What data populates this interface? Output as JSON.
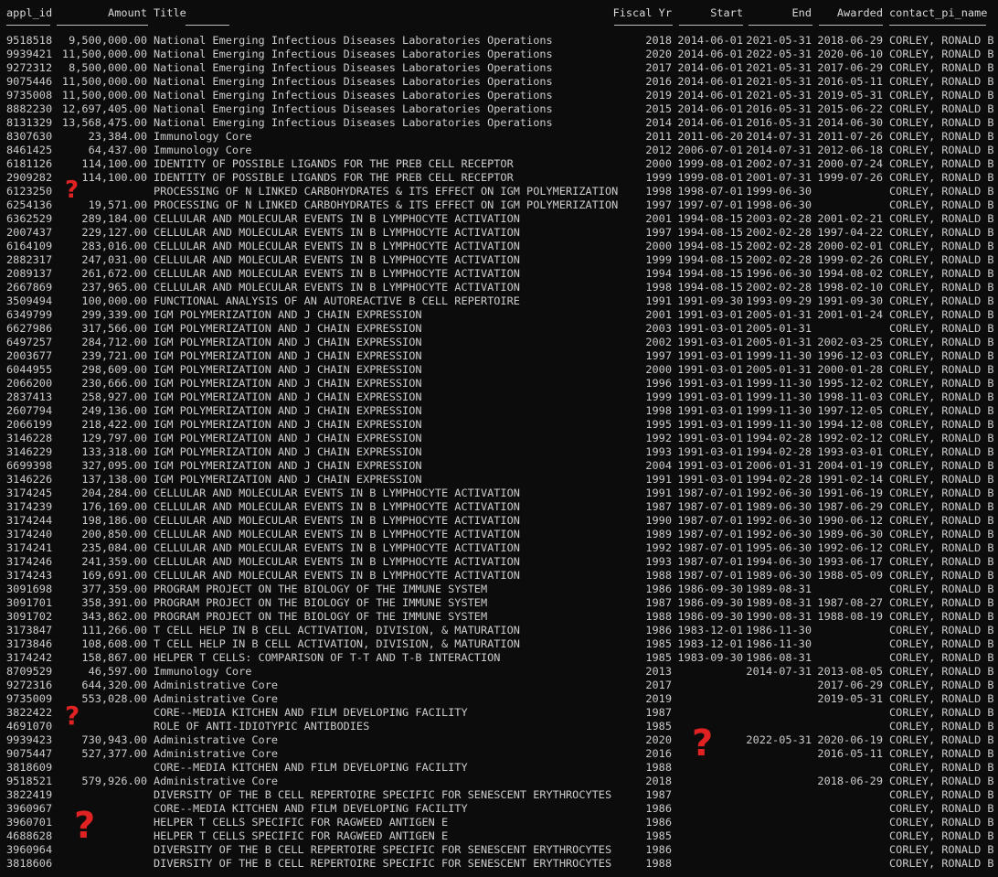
{
  "headers": [
    "appl_id",
    "Amount",
    "Title",
    "Fiscal Yr",
    "Start",
    "End",
    "Awarded",
    "contact_pi_name"
  ],
  "rows": [
    [
      "9518518",
      "9,500,000.00",
      "National Emerging Infectious Diseases Laboratories Operations",
      "2018",
      "2014-06-01",
      "2021-05-31",
      "2018-06-29",
      "CORLEY, RONALD B"
    ],
    [
      "9939421",
      "11,500,000.00",
      "National Emerging Infectious Diseases Laboratories Operations",
      "2020",
      "2014-06-01",
      "2022-05-31",
      "2020-06-10",
      "CORLEY, RONALD B"
    ],
    [
      "9272312",
      "8,500,000.00",
      "National Emerging Infectious Diseases Laboratories Operations",
      "2017",
      "2014-06-01",
      "2021-05-31",
      "2017-06-29",
      "CORLEY, RONALD B"
    ],
    [
      "9075446",
      "11,500,000.00",
      "National Emerging Infectious Diseases Laboratories Operations",
      "2016",
      "2014-06-01",
      "2021-05-31",
      "2016-05-11",
      "CORLEY, RONALD B"
    ],
    [
      "9735008",
      "11,500,000.00",
      "National Emerging Infectious Diseases Laboratories Operations",
      "2019",
      "2014-06-01",
      "2021-05-31",
      "2019-05-31",
      "CORLEY, RONALD B"
    ],
    [
      "8882230",
      "12,697,405.00",
      "National Emerging Infectious Diseases Laboratories Operations",
      "2015",
      "2014-06-01",
      "2016-05-31",
      "2015-06-22",
      "CORLEY, RONALD B"
    ],
    [
      "8131329",
      "13,568,475.00",
      "National Emerging Infectious Diseases Laboratories Operations",
      "2014",
      "2014-06-01",
      "2016-05-31",
      "2014-06-30",
      "CORLEY, RONALD B"
    ],
    [
      "8307630",
      "23,384.00",
      "Immunology Core",
      "2011",
      "2011-06-20",
      "2014-07-31",
      "2011-07-26",
      "CORLEY, RONALD B"
    ],
    [
      "8461425",
      "64,437.00",
      "Immunology Core",
      "2012",
      "2006-07-01",
      "2014-07-31",
      "2012-06-18",
      "CORLEY, RONALD B"
    ],
    [
      "6181126",
      "114,100.00",
      "IDENTITY OF POSSIBLE LIGANDS FOR THE PREB CELL RECEPTOR",
      "2000",
      "1999-08-01",
      "2002-07-31",
      "2000-07-24",
      "CORLEY, RONALD B"
    ],
    [
      "2909282",
      "114,100.00",
      "IDENTITY OF POSSIBLE LIGANDS FOR THE PREB CELL RECEPTOR",
      "1999",
      "1999-08-01",
      "2001-07-31",
      "1999-07-26",
      "CORLEY, RONALD B"
    ],
    [
      "6123250",
      "",
      "PROCESSING OF N LINKED CARBOHYDRATES & ITS EFFECT ON IGM POLYMERIZATION",
      "1998",
      "1998-07-01",
      "1999-06-30",
      "",
      "CORLEY, RONALD B"
    ],
    [
      "6254136",
      "19,571.00",
      "PROCESSING OF N LINKED CARBOHYDRATES & ITS EFFECT ON IGM POLYMERIZATION",
      "1997",
      "1997-07-01",
      "1998-06-30",
      "",
      "CORLEY, RONALD B"
    ],
    [
      "6362529",
      "289,184.00",
      "CELLULAR AND MOLECULAR EVENTS IN B LYMPHOCYTE ACTIVATION",
      "2001",
      "1994-08-15",
      "2003-02-28",
      "2001-02-21",
      "CORLEY, RONALD B"
    ],
    [
      "2007437",
      "229,127.00",
      "CELLULAR AND MOLECULAR EVENTS IN B LYMPHOCYTE ACTIVATION",
      "1997",
      "1994-08-15",
      "2002-02-28",
      "1997-04-22",
      "CORLEY, RONALD B"
    ],
    [
      "6164109",
      "283,016.00",
      "CELLULAR AND MOLECULAR EVENTS IN B LYMPHOCYTE ACTIVATION",
      "2000",
      "1994-08-15",
      "2002-02-28",
      "2000-02-01",
      "CORLEY, RONALD B"
    ],
    [
      "2882317",
      "247,031.00",
      "CELLULAR AND MOLECULAR EVENTS IN B LYMPHOCYTE ACTIVATION",
      "1999",
      "1994-08-15",
      "2002-02-28",
      "1999-02-26",
      "CORLEY, RONALD B"
    ],
    [
      "2089137",
      "261,672.00",
      "CELLULAR AND MOLECULAR EVENTS IN B LYMPHOCYTE ACTIVATION",
      "1994",
      "1994-08-15",
      "1996-06-30",
      "1994-08-02",
      "CORLEY, RONALD B"
    ],
    [
      "2667869",
      "237,965.00",
      "CELLULAR AND MOLECULAR EVENTS IN B LYMPHOCYTE ACTIVATION",
      "1998",
      "1994-08-15",
      "2002-02-28",
      "1998-02-10",
      "CORLEY, RONALD B"
    ],
    [
      "3509494",
      "100,000.00",
      "FUNCTIONAL ANALYSIS OF AN AUTOREACTIVE B CELL REPERTOIRE",
      "1991",
      "1991-09-30",
      "1993-09-29",
      "1991-09-30",
      "CORLEY, RONALD B"
    ],
    [
      "6349799",
      "299,339.00",
      "IGM POLYMERIZATION AND J CHAIN EXPRESSION",
      "2001",
      "1991-03-01",
      "2005-01-31",
      "2001-01-24",
      "CORLEY, RONALD B"
    ],
    [
      "6627986",
      "317,566.00",
      "IGM POLYMERIZATION AND J CHAIN EXPRESSION",
      "2003",
      "1991-03-01",
      "2005-01-31",
      "",
      "CORLEY, RONALD B"
    ],
    [
      "6497257",
      "284,712.00",
      "IGM POLYMERIZATION AND J CHAIN EXPRESSION",
      "2002",
      "1991-03-01",
      "2005-01-31",
      "2002-03-25",
      "CORLEY, RONALD B"
    ],
    [
      "2003677",
      "239,721.00",
      "IGM POLYMERIZATION AND J CHAIN EXPRESSION",
      "1997",
      "1991-03-01",
      "1999-11-30",
      "1996-12-03",
      "CORLEY, RONALD B"
    ],
    [
      "6044955",
      "298,609.00",
      "IGM POLYMERIZATION AND J CHAIN EXPRESSION",
      "2000",
      "1991-03-01",
      "2005-01-31",
      "2000-01-28",
      "CORLEY, RONALD B"
    ],
    [
      "2066200",
      "230,666.00",
      "IGM POLYMERIZATION AND J CHAIN EXPRESSION",
      "1996",
      "1991-03-01",
      "1999-11-30",
      "1995-12-02",
      "CORLEY, RONALD B"
    ],
    [
      "2837413",
      "258,927.00",
      "IGM POLYMERIZATION AND J CHAIN EXPRESSION",
      "1999",
      "1991-03-01",
      "1999-11-30",
      "1998-11-03",
      "CORLEY, RONALD B"
    ],
    [
      "2607794",
      "249,136.00",
      "IGM POLYMERIZATION AND J CHAIN EXPRESSION",
      "1998",
      "1991-03-01",
      "1999-11-30",
      "1997-12-05",
      "CORLEY, RONALD B"
    ],
    [
      "2066199",
      "218,422.00",
      "IGM POLYMERIZATION AND J CHAIN EXPRESSION",
      "1995",
      "1991-03-01",
      "1999-11-30",
      "1994-12-08",
      "CORLEY, RONALD B"
    ],
    [
      "3146228",
      "129,797.00",
      "IGM POLYMERIZATION AND J CHAIN EXPRESSION",
      "1992",
      "1991-03-01",
      "1994-02-28",
      "1992-02-12",
      "CORLEY, RONALD B"
    ],
    [
      "3146229",
      "133,318.00",
      "IGM POLYMERIZATION AND J CHAIN EXPRESSION",
      "1993",
      "1991-03-01",
      "1994-02-28",
      "1993-03-01",
      "CORLEY, RONALD B"
    ],
    [
      "6699398",
      "327,095.00",
      "IGM POLYMERIZATION AND J CHAIN EXPRESSION",
      "2004",
      "1991-03-01",
      "2006-01-31",
      "2004-01-19",
      "CORLEY, RONALD B"
    ],
    [
      "3146226",
      "137,138.00",
      "IGM POLYMERIZATION AND J CHAIN EXPRESSION",
      "1991",
      "1991-03-01",
      "1994-02-28",
      "1991-02-14",
      "CORLEY, RONALD B"
    ],
    [
      "3174245",
      "204,284.00",
      "CELLULAR AND MOLECULAR EVENTS IN B LYMPHOCYTE ACTIVATION",
      "1991",
      "1987-07-01",
      "1992-06-30",
      "1991-06-19",
      "CORLEY, RONALD B"
    ],
    [
      "3174239",
      "176,169.00",
      "CELLULAR AND MOLECULAR EVENTS IN B LYMPHOCYTE ACTIVATION",
      "1987",
      "1987-07-01",
      "1989-06-30",
      "1987-06-29",
      "CORLEY, RONALD B"
    ],
    [
      "3174244",
      "198,186.00",
      "CELLULAR AND MOLECULAR EVENTS IN B LYMPHOCYTE ACTIVATION",
      "1990",
      "1987-07-01",
      "1992-06-30",
      "1990-06-12",
      "CORLEY, RONALD B"
    ],
    [
      "3174240",
      "200,850.00",
      "CELLULAR AND MOLECULAR EVENTS IN B LYMPHOCYTE ACTIVATION",
      "1989",
      "1987-07-01",
      "1992-06-30",
      "1989-06-30",
      "CORLEY, RONALD B"
    ],
    [
      "3174241",
      "235,084.00",
      "CELLULAR AND MOLECULAR EVENTS IN B LYMPHOCYTE ACTIVATION",
      "1992",
      "1987-07-01",
      "1995-06-30",
      "1992-06-12",
      "CORLEY, RONALD B"
    ],
    [
      "3174246",
      "241,359.00",
      "CELLULAR AND MOLECULAR EVENTS IN B LYMPHOCYTE ACTIVATION",
      "1993",
      "1987-07-01",
      "1994-06-30",
      "1993-06-17",
      "CORLEY, RONALD B"
    ],
    [
      "3174243",
      "169,691.00",
      "CELLULAR AND MOLECULAR EVENTS IN B LYMPHOCYTE ACTIVATION",
      "1988",
      "1987-07-01",
      "1989-06-30",
      "1988-05-09",
      "CORLEY, RONALD B"
    ],
    [
      "3091698",
      "377,359.00",
      "PROGRAM PROJECT ON THE BIOLOGY OF THE IMMUNE SYSTEM",
      "1986",
      "1986-09-30",
      "1989-08-31",
      "",
      "CORLEY, RONALD B"
    ],
    [
      "3091701",
      "358,391.00",
      "PROGRAM PROJECT ON THE BIOLOGY OF THE IMMUNE SYSTEM",
      "1987",
      "1986-09-30",
      "1989-08-31",
      "1987-08-27",
      "CORLEY, RONALD B"
    ],
    [
      "3091702",
      "343,862.00",
      "PROGRAM PROJECT ON THE BIOLOGY OF THE IMMUNE SYSTEM",
      "1988",
      "1986-09-30",
      "1990-08-31",
      "1988-08-19",
      "CORLEY, RONALD B"
    ],
    [
      "3173847",
      "111,266.00",
      "T CELL HELP IN B CELL ACTIVATION, DIVISION, & MATURATION",
      "1986",
      "1983-12-01",
      "1986-11-30",
      "",
      "CORLEY, RONALD B"
    ],
    [
      "3173846",
      "108,608.00",
      "T CELL HELP IN B CELL ACTIVATION, DIVISION, & MATURATION",
      "1985",
      "1983-12-01",
      "1986-11-30",
      "",
      "CORLEY, RONALD B"
    ],
    [
      "3174242",
      "158,867.00",
      "HELPER T CELLS: COMPARISON OF T-T AND T-B INTERACTION",
      "1985",
      "1983-09-30",
      "1986-08-31",
      "",
      "CORLEY, RONALD B"
    ],
    [
      "8709529",
      "46,597.00",
      "Immunology Core",
      "2013",
      "",
      "2014-07-31",
      "2013-08-05",
      "CORLEY, RONALD B"
    ],
    [
      "9272316",
      "644,320.00",
      "Administrative Core",
      "2017",
      "",
      "",
      "2017-06-29",
      "CORLEY, RONALD B"
    ],
    [
      "9735009",
      "553,028.00",
      "Administrative Core",
      "2019",
      "",
      "",
      "2019-05-31",
      "CORLEY, RONALD B"
    ],
    [
      "3822422",
      "",
      "CORE--MEDIA KITCHEN AND FILM DEVELOPING FACILITY",
      "1987",
      "",
      "",
      "",
      "CORLEY, RONALD B"
    ],
    [
      "4691070",
      "",
      "ROLE OF ANTI-IDIOTYPIC ANTIBODIES",
      "1985",
      "",
      "",
      "",
      "CORLEY, RONALD B"
    ],
    [
      "9939423",
      "730,943.00",
      "Administrative Core",
      "2020",
      "",
      "2022-05-31",
      "2020-06-19",
      "CORLEY, RONALD B"
    ],
    [
      "9075447",
      "527,377.00",
      "Administrative Core",
      "2016",
      "",
      "",
      "2016-05-11",
      "CORLEY, RONALD B"
    ],
    [
      "3818609",
      "",
      "CORE--MEDIA KITCHEN AND FILM DEVELOPING FACILITY",
      "1988",
      "",
      "",
      "",
      "CORLEY, RONALD B"
    ],
    [
      "9518521",
      "579,926.00",
      "Administrative Core",
      "2018",
      "",
      "",
      "2018-06-29",
      "CORLEY, RONALD B"
    ],
    [
      "3822419",
      "",
      "DIVERSITY OF THE B CELL REPERTOIRE SPECIFIC FOR SENESCENT ERYTHROCYTES",
      "1987",
      "",
      "",
      "",
      "CORLEY, RONALD B"
    ],
    [
      "3960967",
      "",
      "CORE--MEDIA KITCHEN AND FILM DEVELOPING FACILITY",
      "1986",
      "",
      "",
      "",
      "CORLEY, RONALD B"
    ],
    [
      "3960701",
      "",
      "HELPER T CELLS SPECIFIC FOR RAGWEED ANTIGEN E",
      "1986",
      "",
      "",
      "",
      "CORLEY, RONALD B"
    ],
    [
      "4688628",
      "",
      "HELPER T CELLS SPECIFIC FOR RAGWEED ANTIGEN E",
      "1985",
      "",
      "",
      "",
      "CORLEY, RONALD B"
    ],
    [
      "3960964",
      "",
      "DIVERSITY OF THE B CELL REPERTOIRE SPECIFIC FOR SENESCENT ERYTHROCYTES",
      "1986",
      "",
      "",
      "",
      "CORLEY, RONALD B"
    ],
    [
      "3818606",
      "",
      "DIVERSITY OF THE B CELL REPERTOIRE SPECIFIC FOR SENESCENT ERYTHROCYTES",
      "1988",
      "",
      "",
      "",
      "CORLEY, RONALD B"
    ]
  ],
  "annotations": [
    {
      "mark": "?",
      "note": "missing amount"
    },
    {
      "mark": "?",
      "note": "missing amounts"
    },
    {
      "mark": "?",
      "note": "missing start dates"
    },
    {
      "mark": "?",
      "note": "missing amounts"
    }
  ],
  "colors": {
    "background": "#0c0c0c",
    "text": "#cccccc",
    "annotation": "#e02222"
  }
}
